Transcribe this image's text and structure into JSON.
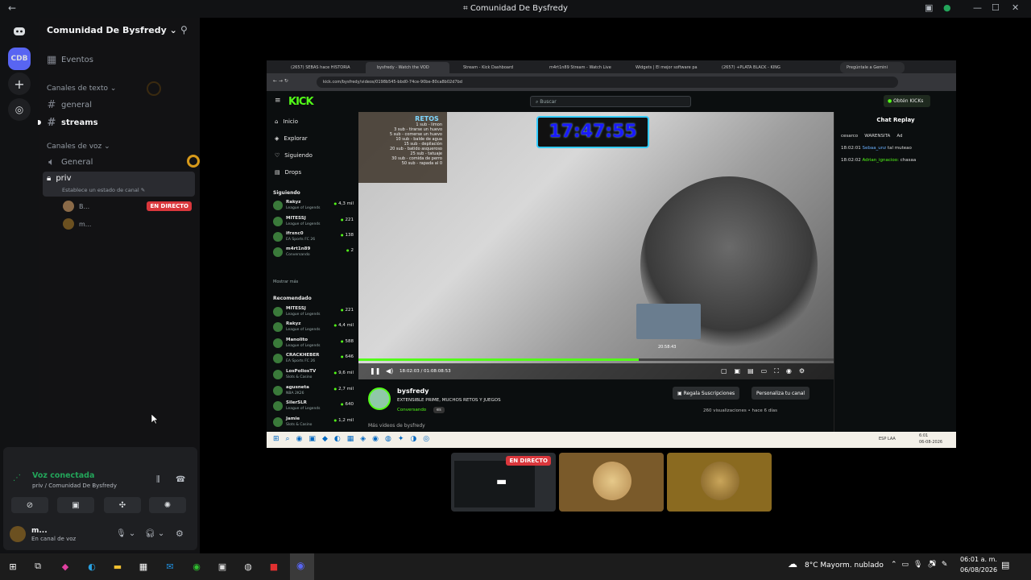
{
  "window": {
    "title": "Comunidad De Bysfredy",
    "back": "←"
  },
  "rail": {
    "servers": [
      {
        "label": "CDB",
        "active": true
      }
    ]
  },
  "sidebar": {
    "server_name": "Comunidad De Bysfredy",
    "events": "Eventos",
    "text_category": "Canales de texto",
    "text_channels": [
      "general",
      "streams"
    ],
    "voice_category": "Canales de voz",
    "voice_channels": [
      "General",
      "priv"
    ],
    "priv_status": "Establece un estado de canal",
    "members": [
      {
        "name": "B...",
        "badge": "EN DIRECTO"
      },
      {
        "name": "m..."
      }
    ]
  },
  "voice": {
    "status": "Voz conectada",
    "location": "priv / Comunidad De Bysfredy",
    "user": "m...",
    "user_status": "En canal de voz"
  },
  "browser": {
    "tabs": [
      "(2657) SEBAS hace HISTORIA",
      "bysfredy - Watch the VOD",
      "Stream - Kick Dashboard",
      "m4rt1n89 Stream - Watch Live",
      "Widgets | El mejor software pa",
      "(2657) +PLATA BLACK - KING"
    ],
    "gemini": "Pregúntale a Gemini",
    "url": "kick.com/bysfredy/videos/0198b545-bbd0-74ce-90be-80ca8b02d7bd"
  },
  "kick": {
    "logo": "KICK",
    "search_placeholder": "Buscar",
    "obtain": "Obtén KICKs",
    "nav": [
      "Inicio",
      "Explorar",
      "Siguiendo",
      "Drops"
    ],
    "following_title": "Siguiendo",
    "following": [
      {
        "name": "Rakyz",
        "game": "League of Legends",
        "viewers": "4,3 mil"
      },
      {
        "name": "MITESSJ",
        "game": "League of Legends",
        "viewers": "221"
      },
      {
        "name": "ifrxnc0",
        "game": "EA Sports FC 26",
        "viewers": "138"
      },
      {
        "name": "m4rt1n89",
        "game": "Conversando",
        "viewers": "2"
      }
    ],
    "show_more": "Mostrar más",
    "recommended_title": "Recomendado",
    "recommended": [
      {
        "name": "MITESSJ",
        "game": "League of Legends",
        "viewers": "221"
      },
      {
        "name": "Rakyz",
        "game": "League of Legends",
        "viewers": "4,4 mil"
      },
      {
        "name": "Manolito",
        "game": "League of Legends",
        "viewers": "588"
      },
      {
        "name": "CRACKHEBER",
        "game": "EA Sports FC 26",
        "viewers": "646"
      },
      {
        "name": "LosPollosTV",
        "game": "Slots & Casino",
        "viewers": "9,6 mil"
      },
      {
        "name": "agusneta",
        "game": "NBA 2K26",
        "viewers": "2,7 mil"
      },
      {
        "name": "SilerSLR",
        "game": "League of Legends",
        "viewers": "640"
      },
      {
        "name": "Jamie",
        "game": "Slots & Casino",
        "viewers": "1,2 mil"
      }
    ],
    "retos_title": "RETOS",
    "retos": [
      "1 sub - limon",
      "3 sub - tirarse un huevo",
      "5 sub - comerse un huevo",
      "10 sub - balde de agua",
      "15 sub - depilación",
      "20 sub - batido asqueroso",
      "25 sub - tatuaje",
      "30 sub - comida de perro",
      "50 sub - rapada al 0"
    ],
    "clock": "17:47:55",
    "timestamp": "20:58:43",
    "time": "18:02:03 / 01:08:08:53",
    "progress": 0.59,
    "channel": "bysfredy",
    "stream_title": "EXTENSIBLE PRIME, MUCHOS RETOS Y JUEGOS",
    "category": "Conversando",
    "lang": "es",
    "gift": "Regala Suscripciones",
    "customize": "Personaliza tu canal",
    "views": "260 visualizaciones",
    "ago": "hace 6 días",
    "more_videos": "Más videos de bysfredy",
    "chat_title": "Chat Replay",
    "chat_top": [
      "cesarco",
      "WARENSITA",
      "Ad"
    ],
    "chat": [
      {
        "time": "18:02:01",
        "user": "Sebaa_unz",
        "msg": "tal muteao"
      },
      {
        "time": "18:02:02",
        "user": "Adrian_ignacioo:",
        "msg": "chasaa"
      }
    ]
  },
  "inner_taskbar": {
    "lang": "ESP LAA",
    "time": "6:01",
    "date": "06-08-2026"
  },
  "thumbs": {
    "live": "EN DIRECTO"
  },
  "taskbar": {
    "weather": "8°C  Mayorm. nublado",
    "time": "06:01 a. m.",
    "date": "06/08/2026"
  }
}
